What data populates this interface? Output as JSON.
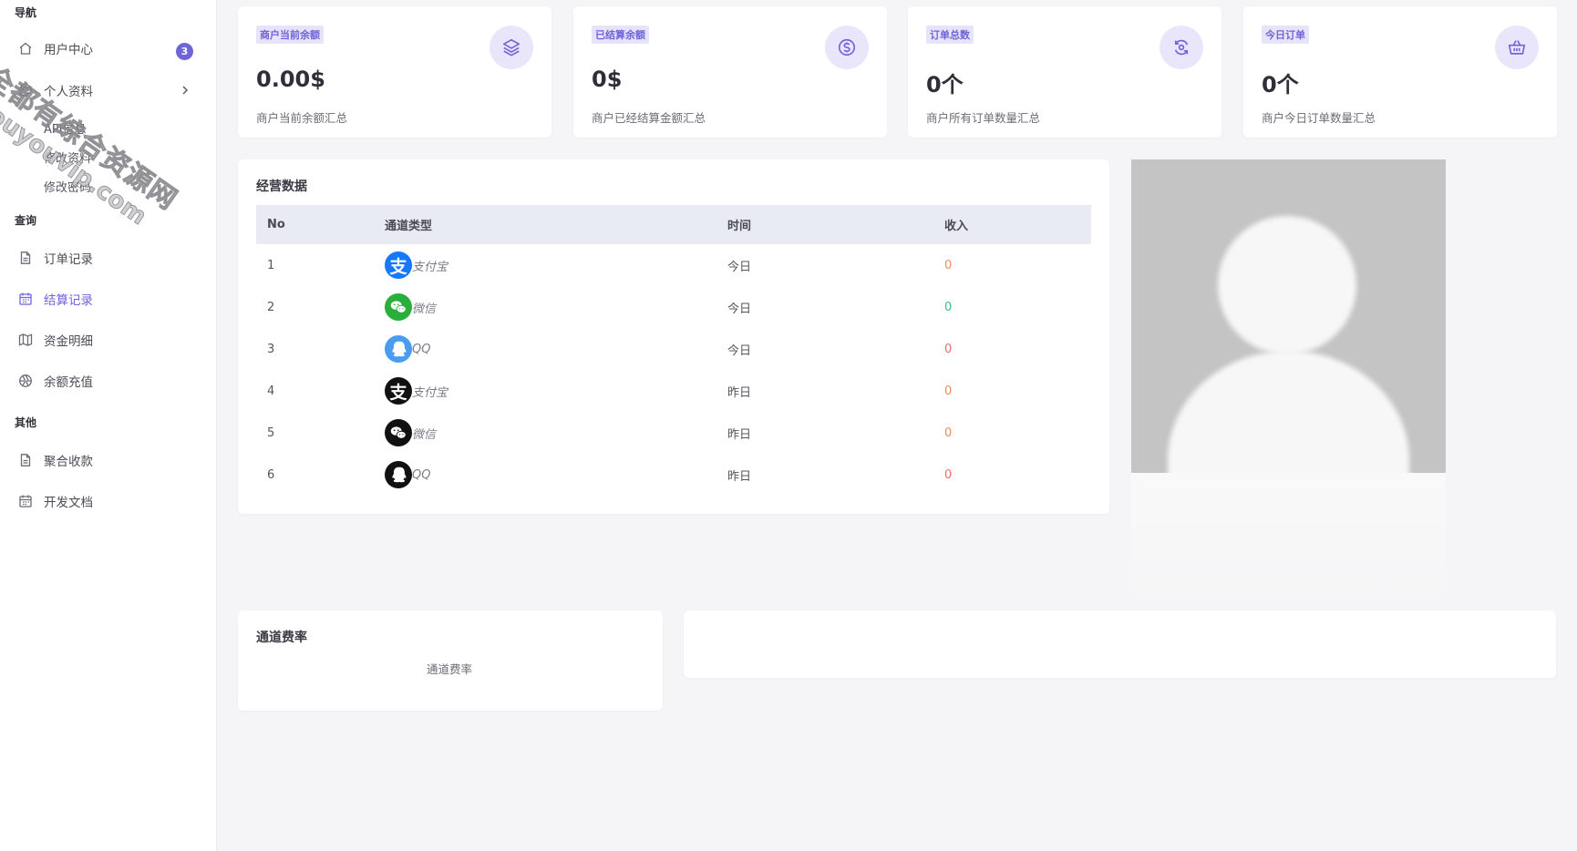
{
  "sidebar": {
    "section_nav": "导航",
    "user_center": "用户中心",
    "user_center_badge": "3",
    "personal_info": "个人资料",
    "sub_api": "API信息",
    "sub_edit_profile": "修改资料",
    "sub_change_password": "修改密码",
    "section_query": "查询",
    "order_records": "订单记录",
    "settlement_records": "结算记录",
    "fund_details": "资金明细",
    "balance_recharge": "余额充值",
    "section_other": "其他",
    "aggregate_payment": "聚合收款",
    "dev_docs": "开发文档"
  },
  "watermark": {
    "line1": "全都有综合资源网",
    "line2": "douyouvip.com"
  },
  "stats": [
    {
      "tag": "商户当前余额",
      "value": "0.00$",
      "desc": "商户当前余额汇总",
      "icon": "layers-icon"
    },
    {
      "tag": "已结算余额",
      "value": "0$",
      "desc": "商户已经结算金额汇总",
      "icon": "dollar-coin-icon"
    },
    {
      "tag": "订单总数",
      "value": "0个",
      "desc": "商户所有订单数量汇总",
      "icon": "refresh-circle-icon"
    },
    {
      "tag": "今日订单",
      "value": "0个",
      "desc": "商户今日订单数量汇总",
      "icon": "basket-icon"
    }
  ],
  "business": {
    "title": "经营数据",
    "headers": {
      "no": "No",
      "channel": "通道类型",
      "time": "时间",
      "income": "收入"
    },
    "rows": [
      {
        "no": "1",
        "channel": "支付宝",
        "time": "今日",
        "income": "0"
      },
      {
        "no": "2",
        "channel": "微信",
        "time": "今日",
        "income": "0"
      },
      {
        "no": "3",
        "channel": "QQ",
        "time": "今日",
        "income": "0"
      },
      {
        "no": "4",
        "channel": "支付宝",
        "time": "昨日",
        "income": "0"
      },
      {
        "no": "5",
        "channel": "微信",
        "time": "昨日",
        "income": "0"
      },
      {
        "no": "6",
        "channel": "QQ",
        "time": "昨日",
        "income": "0"
      }
    ]
  },
  "fee": {
    "title": "通道费率",
    "subtitle": "通道费率"
  },
  "colors": {
    "accent": "#6f64d8",
    "alipay_blue": "#1677ff",
    "wechat_green": "#2aae3c",
    "qq_blue": "#4a9cf0",
    "dark_logo": "#111111"
  }
}
